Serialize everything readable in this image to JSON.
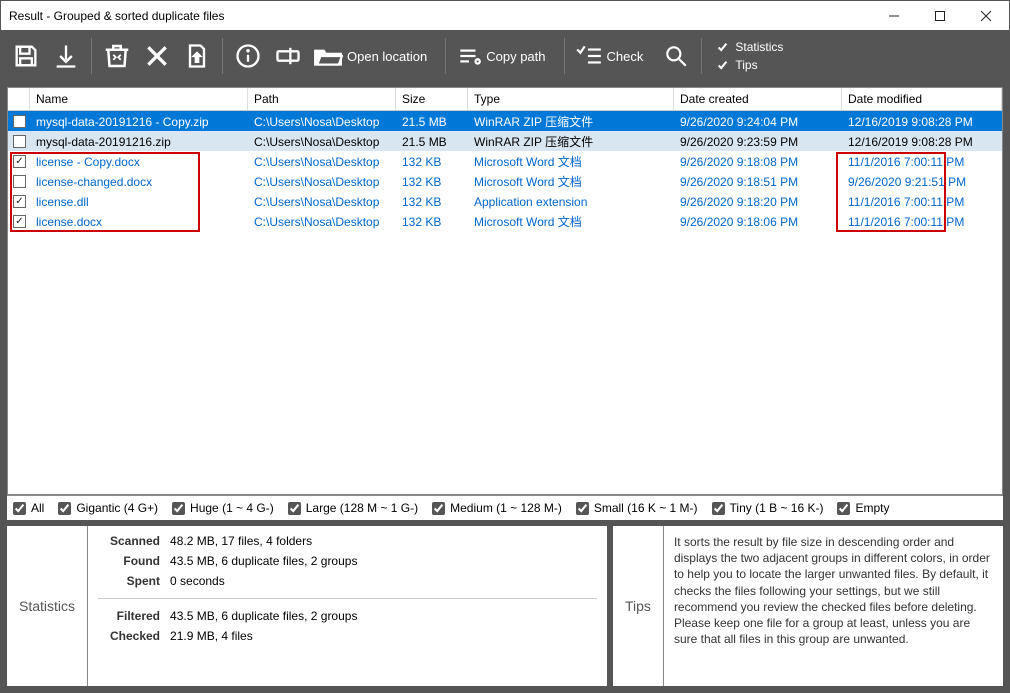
{
  "window": {
    "title": "Result - Grouped & sorted duplicate files"
  },
  "toolbar": {
    "open_location": "Open location",
    "copy_path": "Copy path",
    "check": "Check",
    "stats_cb": "Statistics",
    "tips_cb": "Tips"
  },
  "columns": {
    "name": "Name",
    "path": "Path",
    "size": "Size",
    "type": "Type",
    "created": "Date created",
    "modified": "Date modified"
  },
  "rows": [
    {
      "checked": false,
      "name": "mysql-data-20191216 - Copy.zip",
      "path": "C:\\Users\\Nosa\\Desktop",
      "size": "21.5 MB",
      "type": "WinRAR ZIP 压缩文件",
      "created": "9/26/2020 9:24:04 PM",
      "modified": "12/16/2019 9:08:28 PM",
      "style": "sel"
    },
    {
      "checked": false,
      "name": "mysql-data-20191216.zip",
      "path": "C:\\Users\\Nosa\\Desktop",
      "size": "21.5 MB",
      "type": "WinRAR ZIP 压缩文件",
      "created": "9/26/2020 9:23:59 PM",
      "modified": "12/16/2019 9:08:28 PM",
      "style": "alt"
    },
    {
      "checked": true,
      "name": "license - Copy.docx",
      "path": "C:\\Users\\Nosa\\Desktop",
      "size": "132 KB",
      "type": "Microsoft Word 文档",
      "created": "9/26/2020 9:18:08 PM",
      "modified": "11/1/2016 7:00:11 PM",
      "style": "g2"
    },
    {
      "checked": false,
      "name": "license-changed.docx",
      "path": "C:\\Users\\Nosa\\Desktop",
      "size": "132 KB",
      "type": "Microsoft Word 文档",
      "created": "9/26/2020 9:18:51 PM",
      "modified": "9/26/2020 9:21:51 PM",
      "style": "g2"
    },
    {
      "checked": true,
      "name": "license.dll",
      "path": "C:\\Users\\Nosa\\Desktop",
      "size": "132 KB",
      "type": "Application extension",
      "created": "9/26/2020 9:18:20 PM",
      "modified": "11/1/2016 7:00:11 PM",
      "style": "g2"
    },
    {
      "checked": true,
      "name": "license.docx",
      "path": "C:\\Users\\Nosa\\Desktop",
      "size": "132 KB",
      "type": "Microsoft Word 文档",
      "created": "9/26/2020 9:18:06 PM",
      "modified": "11/1/2016 7:00:11 PM",
      "style": "g2"
    }
  ],
  "filters": {
    "all": "All",
    "gigantic": "Gigantic (4 G+)",
    "huge": "Huge (1 ~ 4 G-)",
    "large": "Large (128 M ~ 1 G-)",
    "medium": "Medium (1 ~ 128 M-)",
    "small": "Small (16 K ~ 1 M-)",
    "tiny": "Tiny (1 B ~ 16 K-)",
    "empty": "Empty"
  },
  "stats": {
    "label": "Statistics",
    "scanned_k": "Scanned",
    "scanned_v": "48.2 MB, 17 files, 4 folders",
    "found_k": "Found",
    "found_v": "43.5 MB, 6 duplicate files, 2 groups",
    "spent_k": "Spent",
    "spent_v": "0 seconds",
    "filtered_k": "Filtered",
    "filtered_v": "43.5 MB, 6 duplicate files, 2 groups",
    "checked_k": "Checked",
    "checked_v": "21.9 MB, 4 files"
  },
  "tips": {
    "label": "Tips",
    "text": "It sorts the result by file size in descending order and displays the two adjacent groups in different colors, in order to help you to locate the larger unwanted files. By default, it checks the files following your settings, but we still recommend you review the checked files before deleting. Please keep one file for a group at least, unless you are sure that all files in this group are unwanted."
  }
}
